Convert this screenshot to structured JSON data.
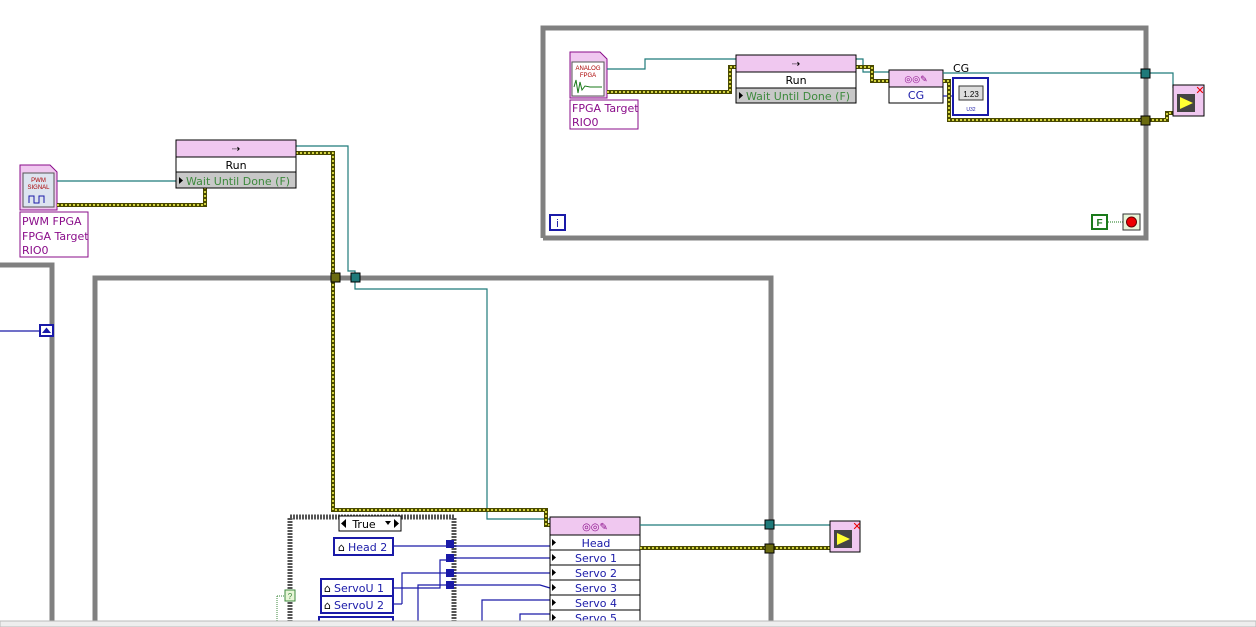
{
  "colors": {
    "loop": "#808080",
    "reference_wire": "#4a4a00",
    "refnum_highlight": "#ffff55",
    "cluster_wire": "#1f7a7a",
    "numeric_wire": "#1a1aa8",
    "node_header": "#f0c8f0",
    "open_ref": "#8a0d8a"
  },
  "pwm_ref": {
    "icon_text": [
      "PWM",
      "SIGNAL"
    ],
    "label_lines": [
      "PWM FPGA",
      "FPGA Target",
      "RIO0"
    ]
  },
  "invoke_node_pwm": {
    "method": "Run",
    "param": "Wait Until Done (F)"
  },
  "analog_ref": {
    "icon_text": [
      "ANALOG",
      "FPGA"
    ],
    "label_lines": [
      "FPGA Target",
      "RIO0"
    ]
  },
  "invoke_node_analog": {
    "method": "Run",
    "param": "Wait Until Done (F)"
  },
  "cg_property_node": {
    "property": "CG",
    "indicator_label": "CG",
    "indicator_value": "1.23",
    "indicator_type": "U32"
  },
  "top_loop": {
    "iteration_terminal": "i",
    "stop_constant": "F",
    "stop_icon": "stop-icon"
  },
  "case_structure": {
    "selector": "True",
    "selector_terminal": "?"
  },
  "local_variables": [
    "Head 2",
    "ServoU 1",
    "ServoU 2"
  ],
  "servo_property_node": {
    "rows": [
      "Head",
      "Servo 1",
      "Servo 2",
      "Servo 3",
      "Servo 4",
      "Servo 5"
    ]
  }
}
